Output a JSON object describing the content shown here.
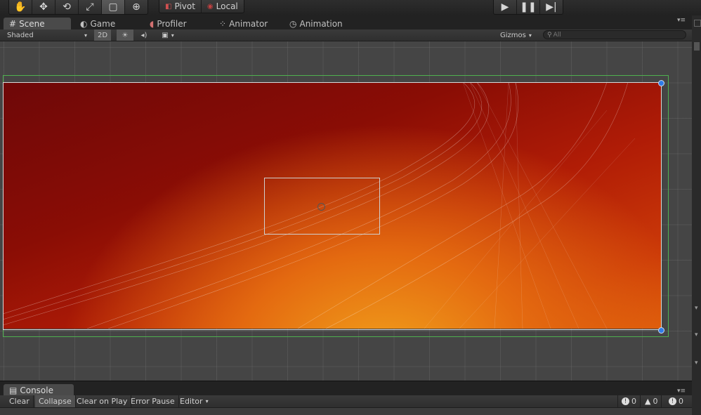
{
  "toolbar": {
    "tools": [
      {
        "name": "hand-tool",
        "icon": "hand-icon",
        "glyph": "✋"
      },
      {
        "name": "move-tool",
        "icon": "move-icon",
        "glyph": "✥"
      },
      {
        "name": "rotate-tool",
        "icon": "rotate-icon",
        "glyph": "⟲"
      },
      {
        "name": "scale-tool",
        "icon": "scale-icon",
        "glyph": "⤢"
      },
      {
        "name": "rect-tool",
        "icon": "rect-icon",
        "glyph": "▢"
      },
      {
        "name": "transform-tool",
        "icon": "transform-icon",
        "glyph": "⊕"
      }
    ],
    "pivot_label": "Pivot",
    "local_label": "Local"
  },
  "tabs": [
    {
      "label": "Scene",
      "icon": "scene-icon",
      "glyph": "#"
    },
    {
      "label": "Game",
      "icon": "game-icon",
      "glyph": "◐"
    },
    {
      "label": "Profiler",
      "icon": "profiler-icon",
      "glyph": "◖"
    },
    {
      "label": "Animator",
      "icon": "animator-icon",
      "glyph": "⁘"
    },
    {
      "label": "Animation",
      "icon": "animation-icon",
      "glyph": "◷"
    }
  ],
  "scene_toolbar": {
    "shading_mode": "Shaded",
    "mode_2d": "2D",
    "gizmos_label": "Gizmos",
    "search_placeholder": "All"
  },
  "console": {
    "tab_label": "Console",
    "buttons": [
      "Clear",
      "Collapse",
      "Clear on Play",
      "Error Pause",
      "Editor"
    ],
    "counts": {
      "info": "0",
      "warning": "0",
      "error": "0"
    }
  },
  "colors": {
    "accent_handle": "#2f7be8",
    "bounds_green": "#4fb04f"
  }
}
